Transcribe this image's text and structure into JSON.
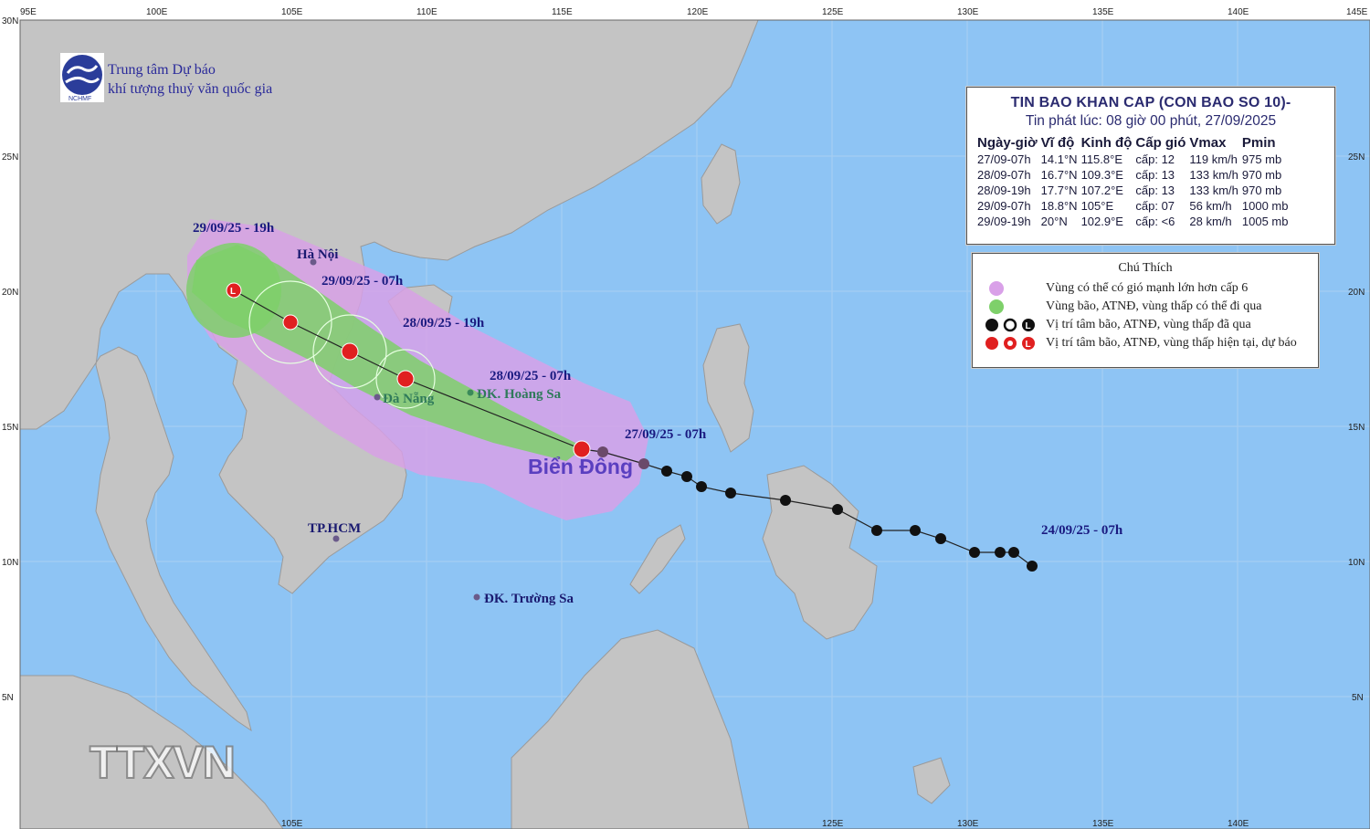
{
  "header": {
    "org_line1": "Trung tâm Dự báo",
    "org_line2": "khí tượng thuỷ văn quốc gia",
    "logo_caption": "NCHMF"
  },
  "bulletin": {
    "title": "TIN BAO KHAN CAP (CON BAO SO 10)-",
    "issued": "Tin phát lúc: 08 giờ 00 phút, 27/09/2025",
    "columns": [
      "Ngày-giờ",
      "Vĩ độ",
      "Kinh độ",
      "Cấp gió",
      "Vmax",
      "Pmin"
    ],
    "rows": [
      [
        "27/09-07h",
        "14.1°N",
        "115.8°E",
        "cấp: 12",
        "119 km/h",
        "975 mb"
      ],
      [
        "28/09-07h",
        "16.7°N",
        "109.3°E",
        "cấp: 13",
        "133 km/h",
        "970 mb"
      ],
      [
        "28/09-19h",
        "17.7°N",
        "107.2°E",
        "cấp: 13",
        "133 km/h",
        "970 mb"
      ],
      [
        "29/09-07h",
        "18.8°N",
        "105°E",
        "cấp: 07",
        "56 km/h",
        "1000 mb"
      ],
      [
        "29/09-19h",
        "20°N",
        "102.9°E",
        "cấp: <6",
        "28 km/h",
        "1005 mb"
      ]
    ]
  },
  "legend": {
    "title": "Chú Thích",
    "items": [
      {
        "text": "Vùng có thể có gió mạnh lớn hơn cấp 6",
        "color": "#d9a0e8"
      },
      {
        "text": "Vùng bão, ATNĐ, vùng thấp có thể đi qua",
        "color": "#7ed06a"
      },
      {
        "text": "Vị trí tâm bão, ATNĐ, vùng thấp đã qua",
        "color": "#111111"
      },
      {
        "text": "Vị trí tâm bão, ATNĐ, vùng thấp hiện tại, dự báo",
        "color": "#e02020"
      }
    ]
  },
  "map_labels": {
    "t_2909_19": "29/09/25 - 19h",
    "t_2909_07": "29/09/25 - 07h",
    "t_2809_19": "28/09/25 - 19h",
    "t_2809_07": "28/09/25 - 07h",
    "t_2709_07": "27/09/25 - 07h",
    "t_2409_07": "24/09/25 - 07h",
    "hanoi": "Hà Nội",
    "danang": "Đà Nẵng",
    "hoangsa": "ĐK. Hoàng Sa",
    "hcm": "TP.HCM",
    "truongsa": "ĐK. Trường Sa",
    "sea": "Biển Đông"
  },
  "axes": {
    "lon_ticks": [
      "95E",
      "100E",
      "105E",
      "110E",
      "115E",
      "120E",
      "125E",
      "130E",
      "135E",
      "140E",
      "145E"
    ],
    "lat_ticks": [
      "30N",
      "25N",
      "20N",
      "15N",
      "10N",
      "5N"
    ]
  },
  "watermark": "TTXVN",
  "colors": {
    "sea": "#8ec4f4",
    "land": "#c4c4c4",
    "wind_zone": "#d9a0e8",
    "storm_zone": "#7ed06a",
    "track": "#111111",
    "current_center": "#e02020"
  }
}
